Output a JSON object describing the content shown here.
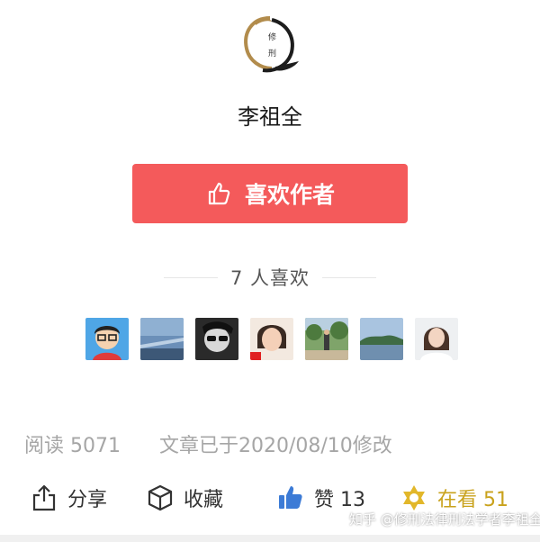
{
  "logo": {
    "text_top": "修",
    "text_bottom": "刑"
  },
  "author": {
    "name": "李祖全"
  },
  "like_button": {
    "label": "喜欢作者"
  },
  "likes": {
    "count_text": "7 人喜欢"
  },
  "avatars": [
    {
      "name": "avatar-cartoon"
    },
    {
      "name": "avatar-sky"
    },
    {
      "name": "avatar-sunglasses"
    },
    {
      "name": "avatar-woman"
    },
    {
      "name": "avatar-park"
    },
    {
      "name": "avatar-lake"
    },
    {
      "name": "avatar-portrait"
    }
  ],
  "meta": {
    "read": "阅读 5071",
    "modified": "文章已于2020/08/10修改"
  },
  "actions": {
    "share": "分享",
    "favorite": "收藏",
    "zan": "赞 13",
    "watching": "在看 51"
  },
  "colors": {
    "primary_button": "#f45a5b",
    "thumb_blue": "#3c7bd6",
    "watch_gold": "#c9a21c"
  },
  "watermark": {
    "text": "知乎 @修刑法律刑法学者李祖全"
  }
}
